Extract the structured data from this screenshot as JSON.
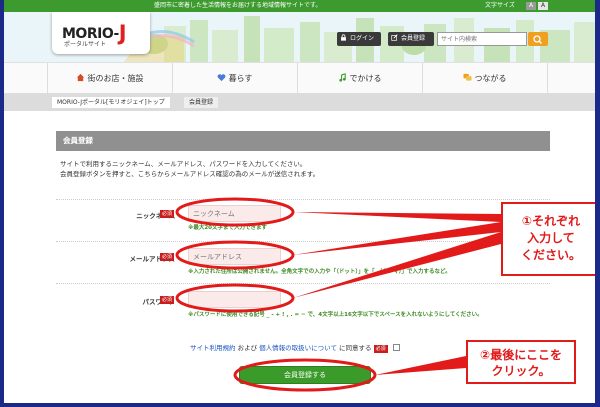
{
  "topbar": {
    "tagline": "盛岡市に密着した生活情報をお届けする地域情報サイトです。",
    "font_size_label": "文字サイズ",
    "font_a_small": "A",
    "font_a_large": "A",
    "bg_color": "#3d9a2e"
  },
  "logo": {
    "main": "MORIO-",
    "j": "J",
    "sub": "ポータルサイト"
  },
  "header": {
    "login_label": "ログイン",
    "register_label": "会員登録",
    "search_placeholder": "サイト内検索"
  },
  "nav": {
    "items": [
      {
        "label": "街のお店・施設",
        "icon": "home-icon"
      },
      {
        "label": "暮らす",
        "icon": "heart-icon"
      },
      {
        "label": "でかける",
        "icon": "music-note-icon"
      },
      {
        "label": "つながる",
        "icon": "chat-icon"
      }
    ]
  },
  "breadcrumb": {
    "home": "MORIO-Jポータル[モリオジェイ]トップ",
    "current": "会員登録"
  },
  "form": {
    "heading": "会員登録",
    "intro_line1": "サイトで利用するニックネーム、メールアドレス、パスワードを入力してください。",
    "intro_line2": "会員登録ボタンを押すと、こちらからメールアドレス確認の為のメールが送信されます。",
    "required_label": "必須",
    "nickname": {
      "label": "ニックネーム",
      "placeholder": "ニックネーム",
      "note": "※最大20文字まで入力できます"
    },
    "email": {
      "label": "メールアドレス",
      "placeholder": "メールアドレス",
      "note": "※入力された住所は公開されません。全角文字での入力や「（ドット）」を「,（カンマ）」で入力するなど。"
    },
    "password": {
      "label": "パスワード",
      "placeholder": "",
      "note": "※パスワードに使用できる記号 _ - + ! , . = ~ で、4文字以上16文字以下でスペースを入れないようにしてください。"
    },
    "agree_terms": "サイト利用規約",
    "agree_and": "および",
    "agree_privacy": "個人情報の取扱いについて",
    "agree_suffix": "に同意する",
    "submit_label": "会員登録する"
  },
  "annotations": {
    "callout1_line1": "①それぞれ",
    "callout1_line2": "入力して",
    "callout1_line3": "ください。",
    "callout2_line1": "②最後にここを",
    "callout2_line2": "クリック。",
    "color": "#e21a1a"
  }
}
